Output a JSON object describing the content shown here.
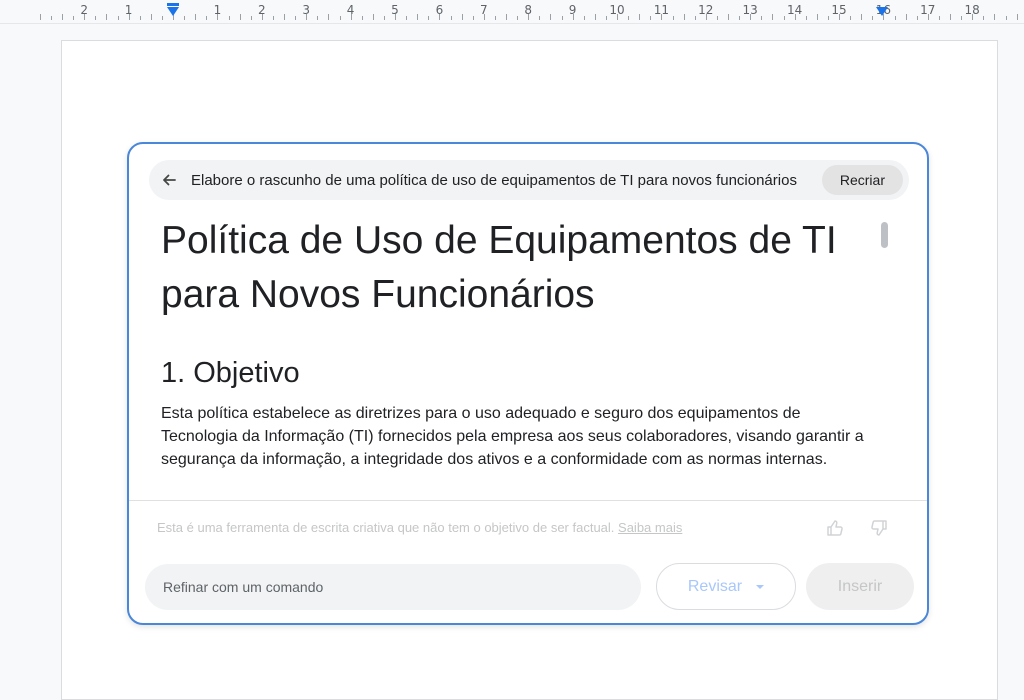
{
  "ruler": {
    "numbers": [
      "2",
      "1",
      "1",
      "2",
      "3",
      "4",
      "5",
      "6",
      "7",
      "8",
      "9",
      "10",
      "11",
      "12",
      "13",
      "14",
      "15",
      "16",
      "17",
      "18"
    ]
  },
  "panel": {
    "prompt": "Elabore o rascunho de uma política de uso de equipamentos de TI para novos funcionários",
    "recreate_label": "Recriar",
    "back_icon": "arrow-left-icon",
    "content": {
      "title": "Política de Uso de Equipamentos de TI para Novos Funcionários",
      "section_heading": "1. Objetivo",
      "paragraph": "Esta política estabelece as diretrizes para o uso adequado e seguro dos equipamentos de Tecnologia da Informação (TI) fornecidos pela empresa aos seus colaboradores, visando garantir a segurança da informação, a integridade dos ativos e a conformidade com as normas internas."
    },
    "disclaimer": "Esta é uma ferramenta de escrita criativa que não tem o objetivo de ser factual.",
    "learn_more": "Saiba mais",
    "refine_placeholder": "Refinar com um comando",
    "revise_label": "Revisar",
    "insert_label": "Inserir"
  },
  "colors": {
    "accent": "#1a73e8",
    "panel_border": "#4a86d9"
  }
}
